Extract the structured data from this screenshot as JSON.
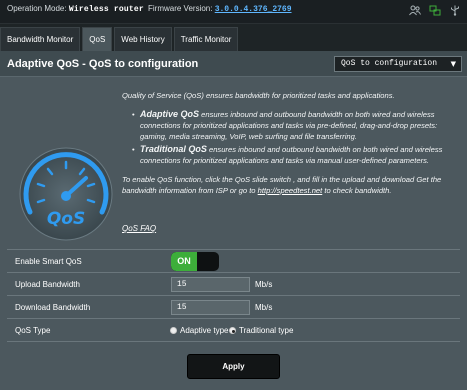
{
  "topbar": {
    "operation_mode_label": "Operation Mode:",
    "operation_mode_value": "Wireless router",
    "firmware_label": "Firmware Version:",
    "firmware_value": "3.0.0.4.376_2769",
    "icons": [
      "users-icon",
      "network-icon",
      "usb-icon"
    ]
  },
  "tabs": [
    {
      "label": "Bandwidth Monitor",
      "active": false
    },
    {
      "label": "QoS",
      "active": true
    },
    {
      "label": "Web History",
      "active": false
    },
    {
      "label": "Traffic Monitor",
      "active": false
    }
  ],
  "header": {
    "title": "Adaptive QoS - QoS to configuration",
    "select_value": "QoS to configuration"
  },
  "gauge": {
    "logo_text": "QoS",
    "icon": "speedometer-icon"
  },
  "description": {
    "intro": "Quality of Service (QoS) ensures bandwidth for prioritized tasks and applications.",
    "adaptive_title": "Adaptive QoS",
    "adaptive_text": "ensures inbound and outbound bandwidth on both wired and wireless connections for prioritized applications and tasks via pre-defined, drag-and-drop presets: gaming, media streaming, VoIP, web surfing and file transferring.",
    "traditional_title": "Traditional QoS",
    "traditional_text": "ensures inbound and outbound bandwidth on both wired and wireless connections for prioritized applications and tasks via manual user-defined parameters.",
    "enable_text_1": "To enable QoS function, click the QoS slide switch , and fill in the upload and download Get the bandwidth information from ISP or go to",
    "speedtest_link": "http://speedtest.net",
    "enable_text_2": "to check bandwidth.",
    "faq_link": "QoS FAQ"
  },
  "form": {
    "enable_label": "Enable Smart QoS",
    "toggle_state": "ON",
    "upload_label": "Upload Bandwidth",
    "upload_value": "15",
    "upload_unit": "Mb/s",
    "download_label": "Download Bandwidth",
    "download_value": "15",
    "download_unit": "Mb/s",
    "qos_type_label": "QoS Type",
    "qos_type_options": [
      "Adaptive type",
      "Traditional type"
    ],
    "qos_type_selected": "Traditional type"
  },
  "apply_label": "Apply",
  "colors": {
    "background": "#1e2426",
    "panel": "#4c585e",
    "toggle_on": "#3dae3a",
    "gauge_blue": "#2f9bf0",
    "link_blue": "#5fb7ff"
  }
}
